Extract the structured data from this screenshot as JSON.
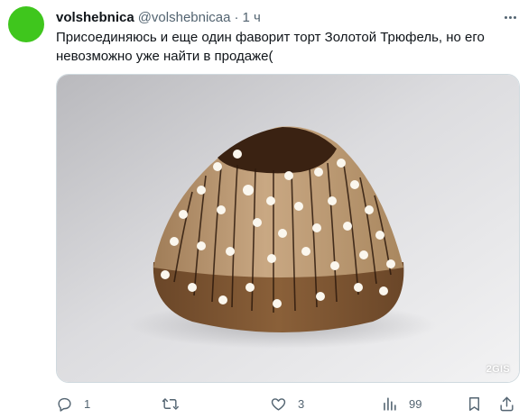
{
  "tweet": {
    "author": {
      "display_name": "volshebnica",
      "handle": "@volshebnicaa",
      "avatar_color": "#3fc61d"
    },
    "separator": "·",
    "time": "1 ч",
    "text": "Присоединяюсь и еще один фаворит торт Золотой Трюфель, но его невозможно уже найти в продаже(",
    "media": {
      "watermark": "2GIS"
    },
    "actions": {
      "reply": {
        "icon": "reply-icon",
        "count": "1"
      },
      "retweet": {
        "icon": "retweet-icon"
      },
      "like": {
        "icon": "heart-icon",
        "count": "3"
      },
      "views": {
        "icon": "views-icon",
        "count": "99"
      },
      "bookmark": {
        "icon": "bookmark-icon"
      },
      "share": {
        "icon": "share-icon"
      }
    }
  }
}
